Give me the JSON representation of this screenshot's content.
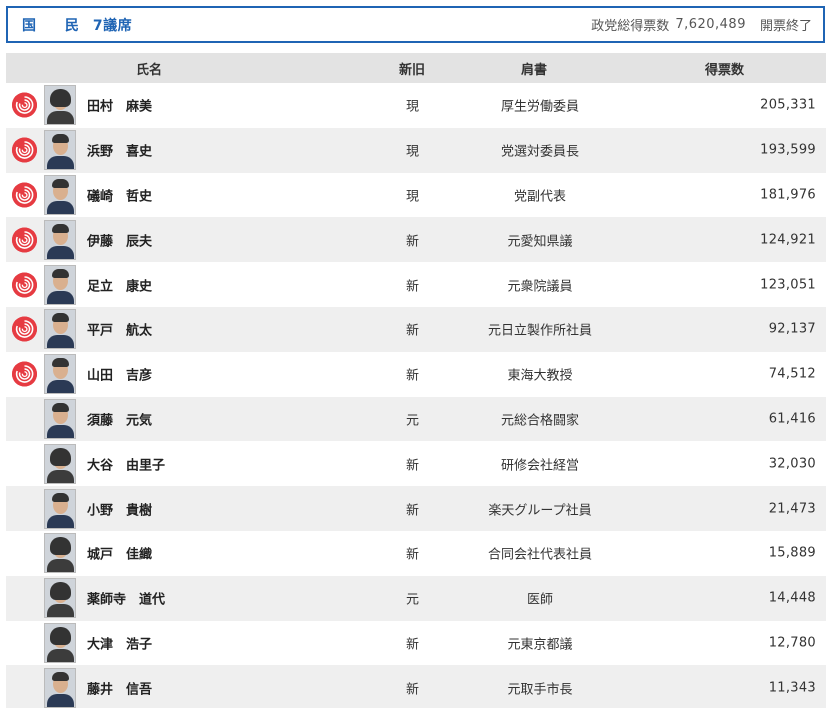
{
  "header": {
    "party": "国 民",
    "seats": "7議席",
    "total_label": "政党総得票数",
    "total_votes": "7,620,489",
    "status": "開票終了"
  },
  "columns": {
    "name": "氏名",
    "newold": "新旧",
    "title": "肩書",
    "votes": "得票数"
  },
  "candidates": [
    {
      "name": "田村　麻美",
      "newold": "現",
      "title": "厚生労働委員",
      "votes": "205,331",
      "elected": true,
      "gender": "f"
    },
    {
      "name": "浜野　喜史",
      "newold": "現",
      "title": "党選対委員長",
      "votes": "193,599",
      "elected": true,
      "gender": "m"
    },
    {
      "name": "礒崎　哲史",
      "newold": "現",
      "title": "党副代表",
      "votes": "181,976",
      "elected": true,
      "gender": "m"
    },
    {
      "name": "伊藤　辰夫",
      "newold": "新",
      "title": "元愛知県議",
      "votes": "124,921",
      "elected": true,
      "gender": "m"
    },
    {
      "name": "足立　康史",
      "newold": "新",
      "title": "元衆院議員",
      "votes": "123,051",
      "elected": true,
      "gender": "m"
    },
    {
      "name": "平戸　航太",
      "newold": "新",
      "title": "元日立製作所社員",
      "votes": "92,137",
      "elected": true,
      "gender": "m"
    },
    {
      "name": "山田　吉彦",
      "newold": "新",
      "title": "東海大教授",
      "votes": "74,512",
      "elected": true,
      "gender": "m"
    },
    {
      "name": "須藤　元気",
      "newold": "元",
      "title": "元総合格闘家",
      "votes": "61,416",
      "elected": false,
      "gender": "m"
    },
    {
      "name": "大谷　由里子",
      "newold": "新",
      "title": "研修会社経営",
      "votes": "32,030",
      "elected": false,
      "gender": "f"
    },
    {
      "name": "小野　貴樹",
      "newold": "新",
      "title": "楽天グループ社員",
      "votes": "21,473",
      "elected": false,
      "gender": "m"
    },
    {
      "name": "城戸　佳織",
      "newold": "新",
      "title": "合同会社代表社員",
      "votes": "15,889",
      "elected": false,
      "gender": "f"
    },
    {
      "name": "薬師寺　道代",
      "newold": "元",
      "title": "医師",
      "votes": "14,448",
      "elected": false,
      "gender": "f"
    },
    {
      "name": "大津　浩子",
      "newold": "新",
      "title": "元東京都議",
      "votes": "12,780",
      "elected": false,
      "gender": "f"
    },
    {
      "name": "藤井　信吾",
      "newold": "新",
      "title": "元取手市長",
      "votes": "11,343",
      "elected": false,
      "gender": "m"
    }
  ],
  "colors": {
    "accent": "#1f64b4",
    "elected_mark": "#e63b42",
    "header_bg": "#e3e3e3",
    "row_alt_bg": "#efefef"
  },
  "icons": {
    "elected": "elected-rose-icon"
  }
}
